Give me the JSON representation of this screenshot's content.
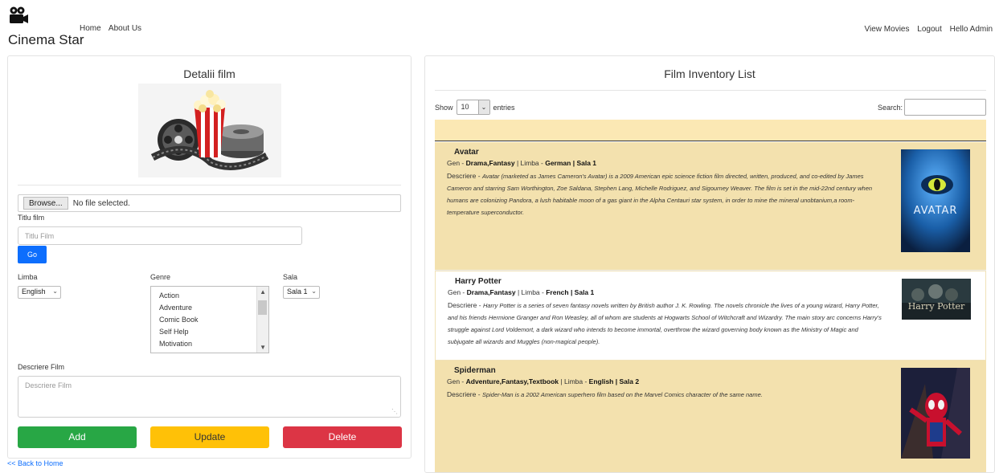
{
  "header": {
    "brand": "Cinema Star",
    "nav_left": [
      "Home",
      "About Us"
    ],
    "nav_right": [
      "View Movies",
      "Logout",
      "Hello Admin"
    ]
  },
  "form": {
    "title": "Detalii film",
    "file_button": "Browse...",
    "file_status": "No file selected.",
    "title_label": "Titlu film",
    "title_placeholder": "Titlu Film",
    "go_label": "Go",
    "limba_label": "Limba",
    "limba_value": "English",
    "genre_label": "Genre",
    "genre_options": [
      "Action",
      "Adventure",
      "Comic Book",
      "Self Help",
      "Motivation"
    ],
    "sala_label": "Sala",
    "sala_value": "Sala 1",
    "descriere_label": "Descriere Film",
    "descriere_placeholder": "Descriere Film",
    "add_label": "Add",
    "update_label": "Update",
    "delete_label": "Delete",
    "back_link": "<< Back to Home"
  },
  "inventory": {
    "title": "Film Inventory List",
    "show_label": "Show",
    "entries_value": "10",
    "entries_label": "entries",
    "search_label": "Search:",
    "movies": [
      {
        "title": "Avatar",
        "gen_label": "Gen - ",
        "gen": "Drama,Fantasy",
        "limba_label": " | Limba - ",
        "limba": "German",
        "sala": "| Sala 1",
        "desc_label": "Descriere - ",
        "desc": "Avatar (marketed as James Cameron's Avatar) is a 2009 American epic science fiction film directed, written, produced, and co-edited by James Cameron and starring Sam Worthington, Zoe Saldana, Stephen Lang, Michelle Rodriguez, and Sigourney Weaver. The film is set in the mid-22nd century when humans are colonizing Pandora, a lush habitable moon of a gas giant in the Alpha Centauri star system, in order to mine the mineral unobtanium,a room-temperature superconductor.",
        "poster_text": "AVATAR"
      },
      {
        "title": "Harry Potter",
        "gen_label": "Gen - ",
        "gen": "Drama,Fantasy",
        "limba_label": " | Limba - ",
        "limba": "French",
        "sala": "| Sala 1",
        "desc_label": "Descriere - ",
        "desc": "Harry Potter is a series of seven fantasy novels written by British author J. K. Rowling. The novels chronicle the lives of a young wizard, Harry Potter, and his friends Hermione Granger and Ron Weasley, all of whom are students at Hogwarts School of Witchcraft and Wizardry. The main story arc concerns Harry's struggle against Lord Voldemort, a dark wizard who intends to become immortal, overthrow the wizard governing body known as the Ministry of Magic and subjugate all wizards and Muggles (non-magical people).",
        "poster_text": "Harry Potter"
      },
      {
        "title": "Spiderman",
        "gen_label": "Gen - ",
        "gen": "Adventure,Fantasy,Textbook",
        "limba_label": " | Limba - ",
        "limba": "English",
        "sala": "| Sala 2",
        "desc_label": "Descriere - ",
        "desc": "Spider-Man is a 2002 American superhero film based on the Marvel Comics character of the same name.",
        "poster_text": ""
      }
    ]
  },
  "colors": {
    "primary": "#0d6efd",
    "success": "#28a745",
    "warning": "#ffc107",
    "danger": "#dc3545",
    "row_highlight": "#f3e1ae"
  }
}
